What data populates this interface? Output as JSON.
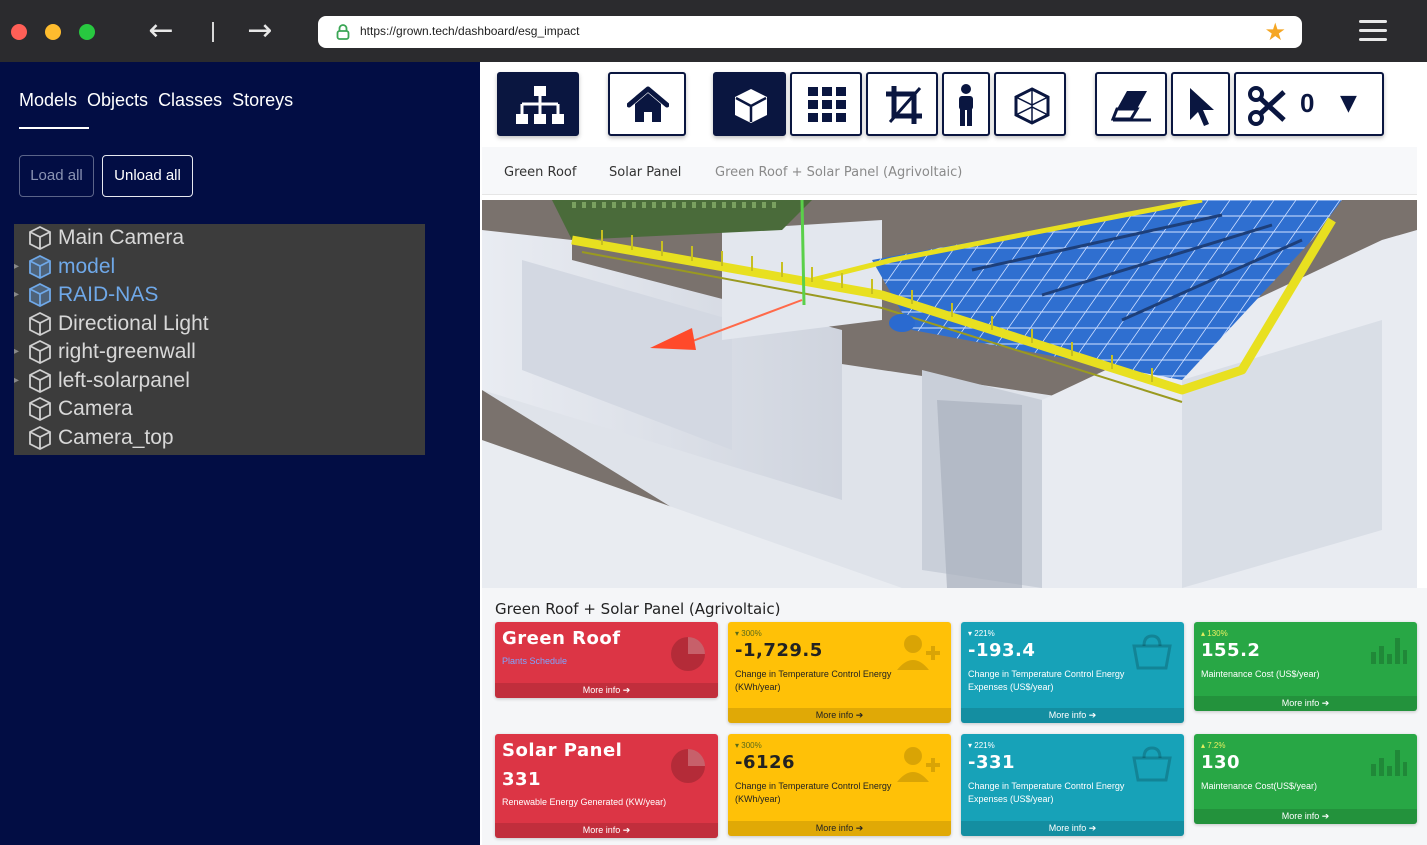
{
  "browser": {
    "url": "https://grown.tech/dashboard/esg_impact",
    "back_glyph": "←",
    "forward_glyph": "→",
    "star_glyph": "★",
    "dot_colors": [
      "#ff5f57",
      "#febc2e",
      "#28c840"
    ]
  },
  "sidebar": {
    "tabs": [
      "Models",
      "Objects",
      "Classes",
      "Storeys"
    ],
    "load_all_label": "Load all",
    "unload_all_label": "Unload all",
    "tree": [
      {
        "label": "Main Camera",
        "expandable": false,
        "highlighted": false
      },
      {
        "label": "model",
        "expandable": true,
        "highlighted": true
      },
      {
        "label": "RAID-NAS",
        "expandable": true,
        "highlighted": true
      },
      {
        "label": "Directional Light",
        "expandable": false,
        "highlighted": false
      },
      {
        "label": "right-greenwall",
        "expandable": true,
        "highlighted": false
      },
      {
        "label": "left-solarpanel",
        "expandable": true,
        "highlighted": false
      },
      {
        "label": "Camera",
        "expandable": false,
        "highlighted": false
      },
      {
        "label": "Camera_top",
        "expandable": false,
        "highlighted": false
      }
    ]
  },
  "toolbar": {
    "buttons": [
      "hierarchy-icon",
      "home-icon",
      "cube-icon",
      "grid-icon",
      "crop-icon",
      "person-icon",
      "wireframe-cube-icon",
      "eraser-icon",
      "cursor-icon",
      "scissors-icon"
    ],
    "clip_count": "0",
    "dropdown_glyph": "▼"
  },
  "view_tabs": [
    "Green Roof",
    "Solar Panel",
    "Green Roof + Solar Panel (Agrivoltaic)"
  ],
  "section_title": "Green Roof + Solar Panel (Agrivoltaic)",
  "cards_row1": {
    "c1": {
      "title": "Green Roof",
      "subtitle": "Plants Schedule",
      "more": "More info ➔"
    },
    "c2": {
      "pct": "▾ 300%",
      "value": "-1,729.5",
      "desc": "Change in Temperature Control Energy (KWh/year)",
      "more": "More info ➔"
    },
    "c3": {
      "pct": "▾ 221%",
      "value": "-193.4",
      "desc": "Change in Temperature Control Energy Expenses (US$/year)",
      "more": "More info ➔"
    },
    "c4": {
      "pct": "▴ 130%",
      "value": "155.2",
      "desc": "Maintenance Cost (US$/year)",
      "more": "More info ➔"
    }
  },
  "cards_row2": {
    "c1": {
      "title": "Solar Panel",
      "value": "331",
      "desc": "Renewable Energy Generated (KW/year)",
      "more": "More info ➔"
    },
    "c2": {
      "pct": "▾ 300%",
      "value": "-6126",
      "desc": "Change in Temperature Control Energy (KWh/year)",
      "more": "More info ➔"
    },
    "c3": {
      "pct": "▾ 221%",
      "value": "-331",
      "desc": "Change in Temperature Control Energy Expenses (US$/year)",
      "more": "More info ➔"
    },
    "c4": {
      "pct": "▴ 7.2%",
      "value": "130",
      "desc": "Maintenance Cost(US$/year)",
      "more": "More info ➔"
    }
  },
  "colors": {
    "sidebar_bg": "#020d44",
    "card_red": "#dc3545",
    "card_yellow": "#ffc107",
    "card_teal": "#17a2b8",
    "card_green": "#28a745",
    "solar_blue": "#2f6fd0",
    "roof_yellow": "#e8e020"
  }
}
